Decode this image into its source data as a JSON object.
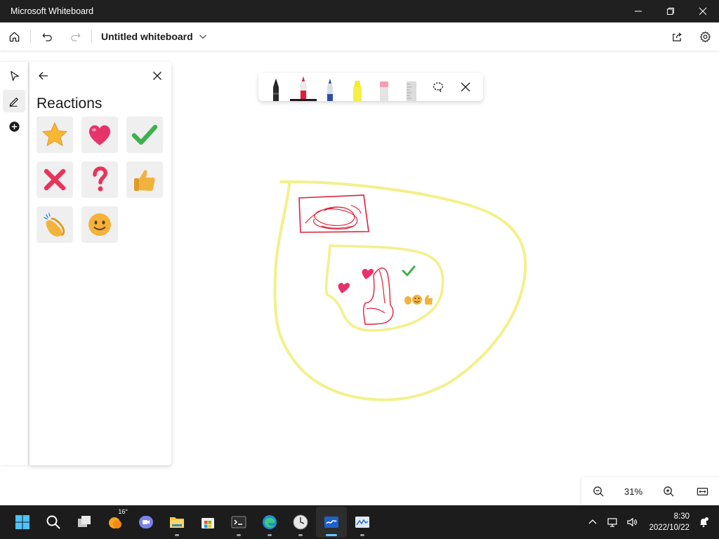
{
  "window": {
    "title": "Microsoft Whiteboard"
  },
  "appbar": {
    "whiteboard_title": "Untitled whiteboard",
    "icons": [
      "home-icon",
      "undo-icon",
      "redo-icon",
      "chevron-down-icon",
      "share-icon",
      "settings-icon"
    ]
  },
  "rail": {
    "items": [
      "select-tool",
      "ink-tool",
      "add-tool"
    ]
  },
  "panel": {
    "title": "Reactions",
    "reactions": [
      "star",
      "heart",
      "checkmark",
      "cross",
      "question",
      "thumbs-up",
      "clapping-hands",
      "smiley"
    ]
  },
  "pen_tray": {
    "pens": [
      "black-pen",
      "red-pen",
      "blue-pen",
      "yellow-highlighter",
      "eraser",
      "ruler"
    ],
    "selected": "red-pen"
  },
  "zoom": {
    "level": "31%"
  },
  "taskbar": {
    "weather_temp": "16°",
    "apps": [
      "start",
      "search",
      "task-view",
      "weather",
      "teams-chat",
      "file-explorer",
      "store",
      "terminal",
      "edge",
      "clock-app",
      "whiteboard",
      "monitor-app"
    ],
    "active_app": "whiteboard",
    "time": "8:30",
    "date": "2022/10/22"
  },
  "colors": {
    "highlighter": "#f3f08a",
    "ink_red": "#e0203a",
    "accent": "#60cdff"
  }
}
